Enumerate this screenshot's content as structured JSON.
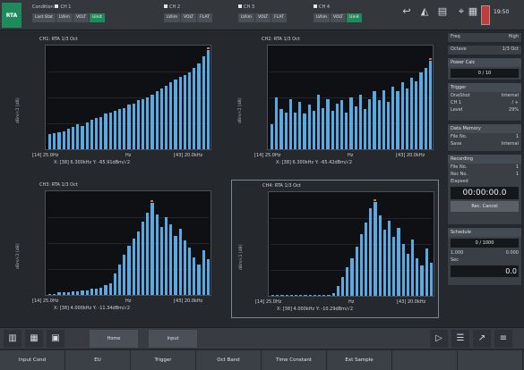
{
  "mode": "RTA",
  "top": {
    "ch1": {
      "head": [
        "Condition",
        "CH 1"
      ],
      "buttons": [
        "Last Stat",
        "LVlim",
        "VOLT",
        "Uinit"
      ]
    },
    "ch2": {
      "head": "CH 2",
      "buttons": [
        "LVlim",
        "VOLT",
        "FLAT"
      ]
    },
    "ch3": {
      "head": "CH 3",
      "buttons": [
        "LVlim",
        "VOLT",
        "FLAT"
      ]
    },
    "ch4": {
      "head": "CH 4",
      "buttons": [
        "LVlim",
        "VOLT",
        "Uinit"
      ]
    },
    "clock": "19:50"
  },
  "panels": [
    {
      "title": "CH1: RTA 1/3 Oct",
      "ylabel": "dBm/√2 [dB]",
      "xleft": "[14] 25.0Hz",
      "xmid": "Hz",
      "xright": "[43] 20.0kHz",
      "cursor": "X: [38] 6.300kHz Y: -65.91dBm/√2"
    },
    {
      "title": "CH2: RTA 1/3 Oct",
      "ylabel": "dBm/√2 [dB]",
      "xleft": "[14] 25.0Hz",
      "xmid": "Hz",
      "xright": "[43] 20.0kHz",
      "cursor": "X: [38] 6.300kHz Y: -65.42dBm/√2"
    },
    {
      "title": "CH3: RTA 1/3 Oct",
      "ylabel": "dBm/√2 [dB]",
      "xleft": "[14] 25.0Hz",
      "xmid": "Hz",
      "xright": "[43] 20.0kHz",
      "cursor": "X: [38] 4.000kHz Y: -11.34dBm/√2"
    },
    {
      "title": "CH4: RTA 1/3 Oct",
      "ylabel": "dBm/√2 [dB]",
      "xleft": "[14] 25.0Hz",
      "xmid": "Hz",
      "xright": "[43] 20.0kHz",
      "cursor": "X: [38] 4.000kHz Y: -10.29dBm/√2"
    }
  ],
  "side": {
    "freq": {
      "label": "Freq",
      "value": "High"
    },
    "octave": {
      "label": "Octave",
      "value": "1/3 Oct"
    },
    "power_calc": {
      "head": "Power Calc",
      "value": "0 / 10"
    },
    "trigger": {
      "head": "Trigger",
      "rows": [
        [
          "OneShot",
          "Internal"
        ],
        [
          "CH 1",
          "/ +"
        ],
        [
          "Level",
          "29%"
        ]
      ]
    },
    "data_memory": {
      "head": "Data Memory",
      "rows": [
        [
          "File No.",
          "1"
        ],
        [
          "Save",
          "Internal"
        ]
      ]
    },
    "recording": {
      "head": "Recording",
      "rows": [
        [
          "File No.",
          "1"
        ],
        [
          "Rec No.",
          "1"
        ]
      ]
    },
    "elapsed_label": "Elapsed",
    "elapsed": "00:00:00.0",
    "rec_cancel": "Rec. Cancel",
    "schedule": {
      "head": "Schedule",
      "v1": "0 / 1000",
      "v2a": "1.000",
      "v2b": "0.000",
      "sec_label": "Sec",
      "sec": "0.0"
    }
  },
  "toolbar": {
    "tab1": "Home",
    "tab2": "Input"
  },
  "fn": [
    "Input Cond",
    "EU",
    "Trigger",
    "Oct Band",
    "Time Constant",
    "Ext Sample"
  ],
  "chart_data": [
    {
      "type": "bar",
      "title": "CH1: RTA 1/3 Oct",
      "ylabel": "dBm/√2 [dB]",
      "ylim": [
        -140,
        0
      ],
      "values": [
        -120,
        -118,
        -117,
        -116,
        -112,
        -110,
        -106,
        -108,
        -104,
        -100,
        -98,
        -96,
        -92,
        -90,
        -88,
        -86,
        -84,
        -80,
        -78,
        -74,
        -72,
        -70,
        -66,
        -62,
        -58,
        -54,
        -50,
        -46,
        -42,
        -40,
        -36,
        -30,
        -24,
        -14,
        -6
      ]
    },
    {
      "type": "bar",
      "title": "CH2: RTA 1/3 Oct",
      "ylabel": "dBm/√2 [dB]",
      "ylim": [
        -140,
        0
      ],
      "values": [
        -106,
        -70,
        -86,
        -90,
        -72,
        -90,
        -76,
        -92,
        -80,
        -88,
        -66,
        -84,
        -72,
        -88,
        -78,
        -74,
        -90,
        -70,
        -82,
        -66,
        -86,
        -72,
        -62,
        -74,
        -60,
        -76,
        -56,
        -62,
        -50,
        -58,
        -44,
        -48,
        -36,
        -30,
        -20
      ]
    },
    {
      "type": "bar",
      "title": "CH3: RTA 1/3 Oct",
      "ylabel": "dB m/√2 [dB]",
      "ylim": [
        -88,
        0
      ],
      "values": [
        -87,
        -87,
        -86,
        -86,
        -86,
        -85,
        -85,
        -84,
        -84,
        -83,
        -83,
        -82,
        -80,
        -78,
        -70,
        -62,
        -54,
        -46,
        -40,
        -34,
        -26,
        -18,
        -10,
        -20,
        -30,
        -22,
        -28,
        -38,
        -32,
        -42,
        -48,
        -56,
        -62,
        -50,
        -58
      ]
    },
    {
      "type": "bar",
      "title": "CH4: RTA 1/3 Oct",
      "ylabel": "dB m/√2 [dB]",
      "ylim": [
        -88,
        0
      ],
      "values": [
        -88,
        -88,
        -88,
        -88,
        -88,
        -88,
        -88,
        -88,
        -88,
        -88,
        -88,
        -88,
        -87,
        -86,
        -80,
        -72,
        -64,
        -56,
        -46,
        -36,
        -26,
        -14,
        -8,
        -20,
        -32,
        -24,
        -38,
        -30,
        -44,
        -52,
        -40,
        -56,
        -62,
        -48,
        -60
      ]
    }
  ]
}
